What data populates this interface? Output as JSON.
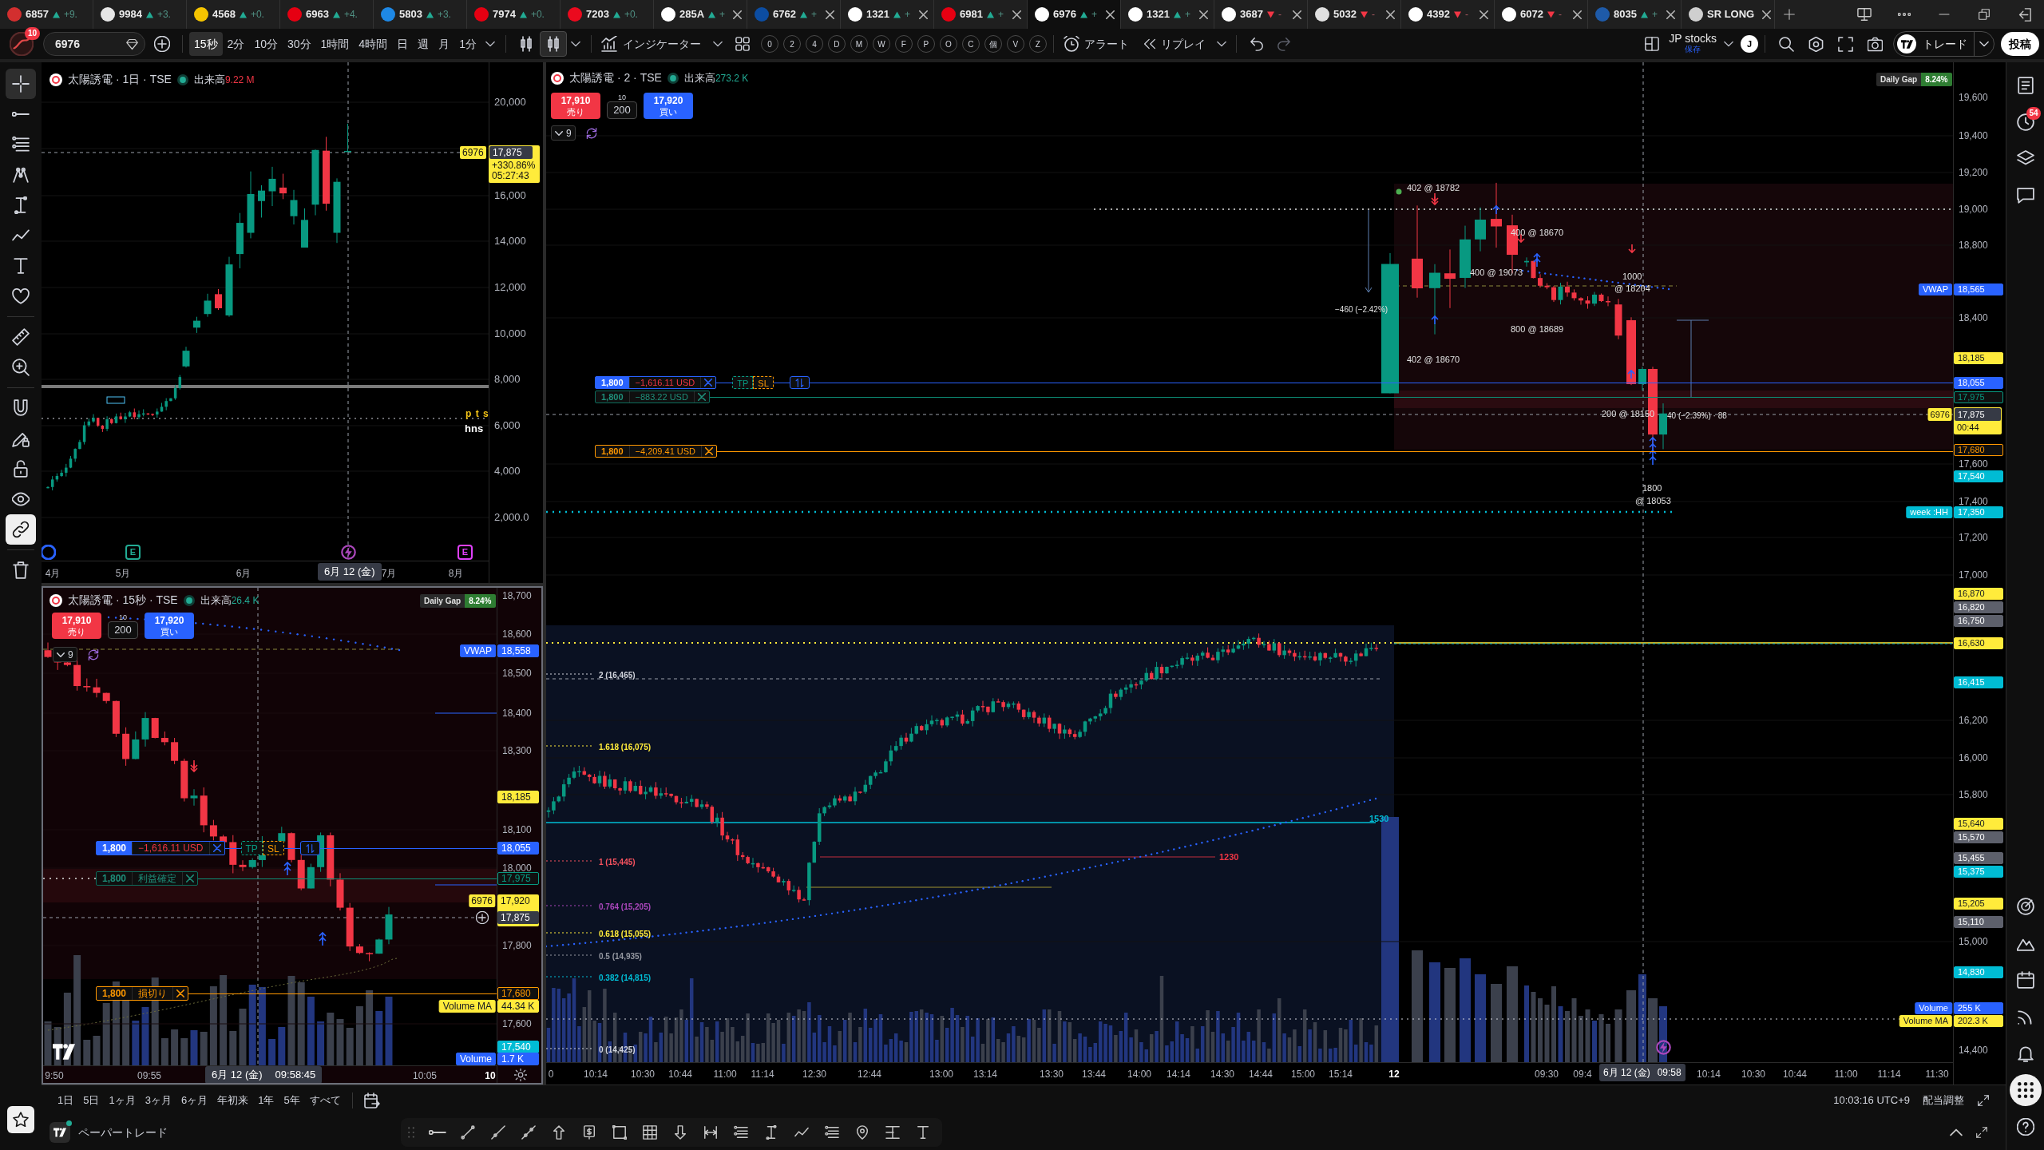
{
  "tabs": [
    {
      "symbol": "6857",
      "rising": true,
      "change": "+9.",
      "closable": false,
      "selected": false,
      "color": "#d32f2f"
    },
    {
      "symbol": "9984",
      "rising": true,
      "change": "+3.",
      "closable": false,
      "selected": false,
      "color": "#e6e6e6"
    },
    {
      "symbol": "4568",
      "rising": true,
      "change": "+0.",
      "closable": false,
      "selected": false,
      "color": "#f5c400"
    },
    {
      "symbol": "6963",
      "rising": true,
      "change": "+4.",
      "closable": false,
      "selected": false,
      "color": "#e60012"
    },
    {
      "symbol": "5803",
      "rising": true,
      "change": "+3.",
      "closable": false,
      "selected": false,
      "color": "#1e88e5"
    },
    {
      "symbol": "7974",
      "rising": true,
      "change": "+0.",
      "closable": false,
      "selected": false,
      "color": "#e60012"
    },
    {
      "symbol": "7203",
      "rising": true,
      "change": "+0.",
      "closable": false,
      "selected": false,
      "color": "#eb0a1e"
    },
    {
      "symbol": "285A",
      "rising": true,
      "change": "+",
      "closable": true,
      "selected": false,
      "color": "#ffffff"
    },
    {
      "symbol": "6762",
      "rising": true,
      "change": "+",
      "closable": true,
      "selected": false,
      "color": "#0c4da2"
    },
    {
      "symbol": "1321",
      "rising": true,
      "change": "+",
      "closable": true,
      "selected": false,
      "color": "#ffffff"
    },
    {
      "symbol": "6981",
      "rising": true,
      "change": "+",
      "closable": true,
      "selected": false,
      "color": "#e60012"
    },
    {
      "symbol": "6976",
      "rising": true,
      "change": "+",
      "closable": true,
      "selected": true,
      "color": "#ffffff"
    },
    {
      "symbol": "1321",
      "rising": true,
      "change": "+",
      "closable": true,
      "selected": false,
      "color": "#ffffff"
    },
    {
      "symbol": "3687",
      "rising": false,
      "change": "-",
      "closable": true,
      "selected": false,
      "color": "#ffffff"
    },
    {
      "symbol": "5032",
      "rising": false,
      "change": "-",
      "closable": true,
      "selected": false,
      "color": "#e0e0e0"
    },
    {
      "symbol": "4392",
      "rising": false,
      "change": "-",
      "closable": true,
      "selected": false,
      "color": "#ffffff"
    },
    {
      "symbol": "6072",
      "rising": false,
      "change": "-",
      "closable": true,
      "selected": false,
      "color": "#ffffff"
    },
    {
      "symbol": "8035",
      "rising": true,
      "change": "+",
      "closable": true,
      "selected": false,
      "color": "#1e5aa8"
    },
    {
      "symbol": "SR LONG",
      "closable": true,
      "selected": false,
      "color": "#cfcfcf"
    }
  ],
  "toolbar": {
    "badge": "10",
    "symbol": "6976",
    "intervals": [
      {
        "label": "15秒",
        "selected": true
      },
      {
        "label": "2分",
        "selected": false
      },
      {
        "label": "10分",
        "selected": false
      },
      {
        "label": "30分",
        "selected": false
      },
      {
        "label": "1時間",
        "selected": false
      },
      {
        "label": "4時間",
        "selected": false
      },
      {
        "label": "日",
        "selected": false
      },
      {
        "label": "週",
        "selected": false
      },
      {
        "label": "月",
        "selected": false
      },
      {
        "label": "1分",
        "selected": false
      }
    ],
    "chart_styles": [
      {
        "selected": false
      },
      {
        "selected": true
      }
    ],
    "indicators": "インジケーター",
    "shortcuts": [
      "0",
      "2",
      "4",
      "D",
      "M",
      "W",
      "F",
      "P",
      "O",
      "C",
      "個",
      "V",
      "Z"
    ],
    "alert": "アラート",
    "replay": "リプレイ",
    "layout_name": "JP stocks",
    "layout_status": "保存",
    "user": "J",
    "trade": "トレード",
    "publish": "投稿"
  },
  "left_toolbar": {
    "tools": [
      {
        "selected": true
      },
      {
        "selected": false
      },
      {
        "selected": false
      },
      {
        "selected": false
      },
      {
        "selected": false
      },
      {
        "selected": false
      },
      {
        "selected": false
      },
      {
        "selected": false
      }
    ],
    "aids": [
      {
        "selected": false
      },
      {
        "selected": false
      }
    ],
    "toggles": [
      {
        "on": false
      },
      {
        "on": false
      },
      {
        "on": false
      },
      {
        "on": false
      },
      {
        "on": true
      }
    ],
    "favorites": {
      "on": true
    }
  },
  "charts": [
    {
      "title": "太陽誘電 · 1日 · TSE",
      "volume_label": "出来高",
      "volume": "9.22 M",
      "volume_falling": true,
      "price_ticks": [
        "20,000",
        "16,000",
        "14,000",
        "12,000",
        "10,000",
        "8,000",
        "6,000",
        "4,000",
        "2,000.0"
      ],
      "last_price": {
        "label": "6976",
        "details": [
          "+330.86%",
          "05:27:43"
        ]
      },
      "crosshair": {
        "price": "17,875",
        "date": "6月 12 (金)"
      },
      "drawing_labels": [
        {
          "text": "p t s",
          "color": "#f5c518"
        },
        {
          "text": "hns",
          "color": "#ffffff"
        }
      ],
      "events": [
        {
          "kind": "dot",
          "color": "#2962ff"
        },
        {
          "kind": "letter",
          "text": "E",
          "color": "#22ab94"
        },
        {
          "kind": "bolt",
          "color": "#ab47bc"
        },
        {
          "kind": "letter",
          "text": "E",
          "color": "#e040fb"
        }
      ],
      "time_ticks": [
        "4月",
        "5月",
        "6月",
        "7月",
        "8月"
      ]
    },
    {
      "title": "太陽誘電 · 15秒 · TSE",
      "volume_label": "出来高",
      "volume": "26.4 K",
      "volume_falling": false,
      "daily_gap": {
        "label": "Daily Gap",
        "value": "8.24%"
      },
      "trade_panel": {
        "sell_price": "17,910",
        "sell": "売り",
        "spread": "10",
        "quantity": "200",
        "buy_price": "17,920",
        "buy": "買い"
      },
      "legend_count": "9",
      "orders": [
        {
          "kind": "position",
          "quantity": "1,800",
          "text": "−1,616.11 USD",
          "tp": "TP",
          "sl": "SL"
        },
        {
          "kind": "take_profit",
          "quantity": "1,800",
          "text": "利益確定"
        },
        {
          "kind": "stop_loss",
          "quantity": "1,800",
          "text": "損切り"
        }
      ],
      "price_ticks": [
        "18,700",
        "18,600",
        "18,500",
        "18,400",
        "18,300",
        "18,100",
        "18,000",
        "17,800",
        "17,600"
      ],
      "axis_tags": [
        {
          "text": "18,558",
          "label": "VWAP",
          "color": "#2962ff"
        },
        {
          "text": "18,185",
          "color": "#ffeb3b"
        },
        {
          "text": "18,055",
          "color": "#2962ff"
        },
        {
          "text": "17,975",
          "color": "#089981",
          "outline": true
        },
        {
          "text": "17,680",
          "color": "#ff9800",
          "outline": true
        },
        {
          "text": "44.34 K",
          "label": "Volume MA",
          "color": "#ffeb3b"
        },
        {
          "text": "17,540",
          "color": "#00bcd4"
        },
        {
          "text": "1.7 K",
          "label": "Volume",
          "color": "#2962ff"
        }
      ],
      "last_price": {
        "label": "6976",
        "price": "17,920"
      },
      "crosshair": {
        "price": "17,875",
        "date": "6月 12 (金)",
        "time": "09:58:45"
      },
      "time_ticks": [
        "9:50",
        "09:55",
        "10:05",
        "10"
      ]
    },
    {
      "title": "太陽誘電 · 2 · TSE",
      "volume_label": "出来高",
      "volume": "273.2 K",
      "volume_falling": false,
      "daily_gap": {
        "label": "Daily Gap",
        "value": "8.24%"
      },
      "trade_panel": {
        "sell_price": "17,910",
        "sell": "売り",
        "spread": "10",
        "quantity": "200",
        "buy_price": "17,920",
        "buy": "買い"
      },
      "legend_count": "9",
      "orders": [
        {
          "kind": "position",
          "quantity": "1,800",
          "text": "−1,616.11 USD",
          "tp": "TP",
          "sl": "SL"
        },
        {
          "kind": "take_profit",
          "quantity": "1,800",
          "text": "−883.22 USD"
        },
        {
          "kind": "stop_loss",
          "quantity": "1,800",
          "text": "−4,209.41 USD"
        }
      ],
      "trade_labels": [
        "402 @ 18782",
        "400 @ 18670",
        "400 @ 19073",
        "1000",
        "@ 18204",
        "800 @ 18689",
        "402 @ 18670",
        "−460 (−2.42%)",
        "200 @ 18150",
        "1800",
        "@ 18053",
        "40 (−2.39%) · 88"
      ],
      "fib_levels": [
        {
          "text": "2 (16,465)",
          "color": "#d1d4dc"
        },
        {
          "text": "1.618 (16,075)",
          "color": "#ffeb3b"
        },
        {
          "text": "1 (15,445)",
          "color": "#f7525f"
        },
        {
          "text": "0.764 (15,205)",
          "color": "#ab47bc"
        },
        {
          "text": "0.618 (15,055)",
          "color": "#ffeb3b"
        },
        {
          "text": "0.5 (14,935)",
          "color": "#9598a1"
        },
        {
          "text": "0.382 (14,815)",
          "color": "#00bcd4"
        },
        {
          "text": "0 (14,425)",
          "color": "#d1d4dc"
        }
      ],
      "line_labels": [
        {
          "text": "1530",
          "color": "#00bcd4"
        },
        {
          "text": "1230",
          "color": "#f23645"
        }
      ],
      "price_ticks": [
        "19,600",
        "19,400",
        "19,200",
        "19,000",
        "18,800",
        "18,400",
        "17,600",
        "17,400",
        "17,200",
        "17,000",
        "16,200",
        "16,000",
        "15,800",
        "15,000",
        "14,400"
      ],
      "axis_tags": [
        {
          "text": "18,565",
          "label": "VWAP",
          "color": "#2962ff"
        },
        {
          "text": "18,185",
          "color": "#ffeb3b"
        },
        {
          "text": "18,055",
          "color": "#2962ff"
        },
        {
          "text": "17,975",
          "color": "#089981",
          "outline": true
        },
        {
          "text": "17,680",
          "color": "#ff9800",
          "outline": true
        },
        {
          "text": "17,540",
          "color": "#00bcd4"
        },
        {
          "text": "17,350",
          "label": "week :HH",
          "color": "#00bcd4"
        },
        {
          "text": "16,870",
          "color": "#ffeb3b"
        },
        {
          "text": "16,820",
          "color": "#5d606b"
        },
        {
          "text": "16,750",
          "color": "#5d606b"
        },
        {
          "text": "16,630",
          "color": "#ffeb3b"
        },
        {
          "text": "16,415",
          "color": "#00bcd4"
        },
        {
          "text": "15,640",
          "color": "#ffeb3b"
        },
        {
          "text": "15,570",
          "color": "#5d606b"
        },
        {
          "text": "15,455",
          "color": "#5d606b"
        },
        {
          "text": "15,375",
          "color": "#00bcd4"
        },
        {
          "text": "15,205",
          "color": "#ffeb3b"
        },
        {
          "text": "15,110",
          "color": "#5d606b"
        },
        {
          "text": "14,830",
          "color": "#00bcd4"
        },
        {
          "text": "255 K",
          "label": "Volume",
          "color": "#2962ff"
        },
        {
          "text": "202.3 K",
          "label": "Volume MA",
          "color": "#ffeb3b"
        }
      ],
      "last_price": {
        "label": "6976",
        "details": [
          "00:44"
        ]
      },
      "crosshair": {
        "price": "17,875",
        "date": "6月 12 (金)",
        "time": "09:58"
      },
      "events": [
        {
          "kind": "bolt",
          "color": "#ab47bc"
        }
      ],
      "time_ticks": [
        "0",
        "10:14",
        "10:30",
        "10:44",
        "11:00",
        "11:14",
        "12:30",
        "12:44",
        "13:00",
        "13:14",
        "13:30",
        "13:44",
        "14:00",
        "14:14",
        "14:30",
        "14:44",
        "15:00",
        "15:14",
        "12",
        "09:30",
        "09:4",
        "10:14",
        "10:30",
        "10:44",
        "11:00",
        "11:14",
        "11:30"
      ]
    }
  ],
  "range_bar": {
    "ranges": [
      "1日",
      "5日",
      "1ヶ月",
      "3ヶ月",
      "6ヶ月",
      "年初来",
      "1年",
      "5年",
      "すべて"
    ],
    "clock": "10:03:16 UTC+9",
    "adjust": "配当調整"
  },
  "bottom_panel": {
    "title": "ペーパートレード"
  },
  "right_sidebar": {
    "items": [
      {
        "selected": false
      },
      {
        "selected": false,
        "badge": "54"
      },
      {
        "selected": false
      },
      {
        "selected": false
      },
      {
        "selected": false
      },
      {
        "selected": false
      },
      {
        "selected": false
      },
      {
        "selected": false
      },
      {
        "selected": false
      },
      {
        "selected": true
      },
      {
        "selected": false
      }
    ]
  }
}
